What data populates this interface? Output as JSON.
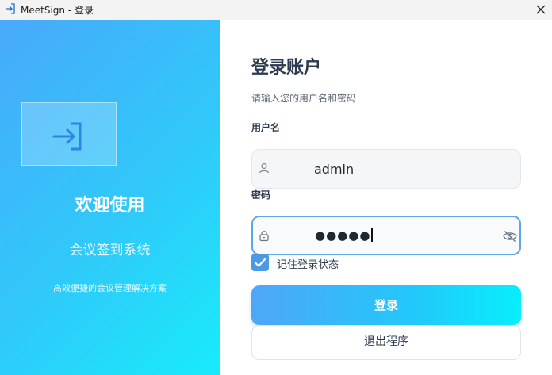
{
  "window": {
    "title": "MeetSign - 登录",
    "app_icon": "login-arrow-icon",
    "close_icon": "close-icon"
  },
  "left_panel": {
    "icon": "login-arrow-icon",
    "welcome": "欢迎使用",
    "system_name": "会议签到系统",
    "tagline": "高效便捷的会议管理解决方案",
    "gradient": [
      "#48a9fb",
      "#18ebfb"
    ]
  },
  "form": {
    "title": "登录账户",
    "subtitle": "请输入您的用户名和密码",
    "username_label": "用户名",
    "username_value": "admin",
    "username_icon": "user-icon",
    "password_label": "密码",
    "password_display": "●●●●●",
    "password_icon": "lock-icon",
    "toggle_icon": "eye-off-icon",
    "remember_label": "记住登录状态",
    "remember_checked": true,
    "login_button": "登录",
    "exit_button": "退出程序"
  },
  "colors": {
    "accent": "#4a9ae6",
    "focus_border": "#5aa8e8",
    "heading": "#2b3a4e"
  }
}
